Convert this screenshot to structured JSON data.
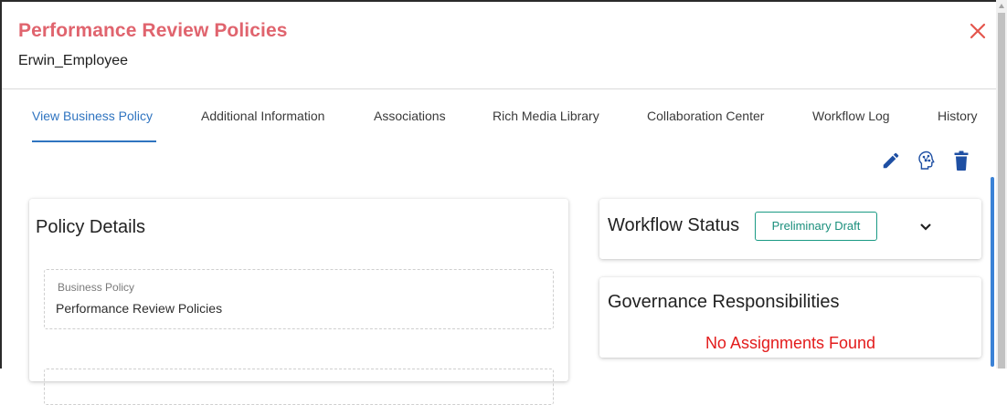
{
  "dialog": {
    "title": "Performance Review Policies",
    "subtitle": "Erwin_Employee"
  },
  "tabs": [
    {
      "label": "View Business Policy",
      "active": true
    },
    {
      "label": "Additional Information",
      "active": false
    },
    {
      "label": "Associations",
      "active": false
    },
    {
      "label": "Rich Media Library",
      "active": false
    },
    {
      "label": "Collaboration Center",
      "active": false
    },
    {
      "label": "Workflow Log",
      "active": false
    },
    {
      "label": "History",
      "active": false
    }
  ],
  "toolbar": {
    "icons": [
      "edit-icon",
      "mind-map-icon",
      "delete-icon"
    ]
  },
  "policy_details": {
    "title": "Policy Details",
    "fields": [
      {
        "label": "Business Policy",
        "value": "Performance Review Policies"
      }
    ]
  },
  "workflow": {
    "title": "Workflow Status",
    "status": "Preliminary Draft"
  },
  "governance": {
    "title": "Governance Responsibilities",
    "empty_message": "No Assignments Found"
  },
  "colors": {
    "title": "#e0646e",
    "accent": "#2f74c0",
    "status": "#1a9a84",
    "error": "#e31b1b",
    "icon": "#1e4fa3"
  }
}
